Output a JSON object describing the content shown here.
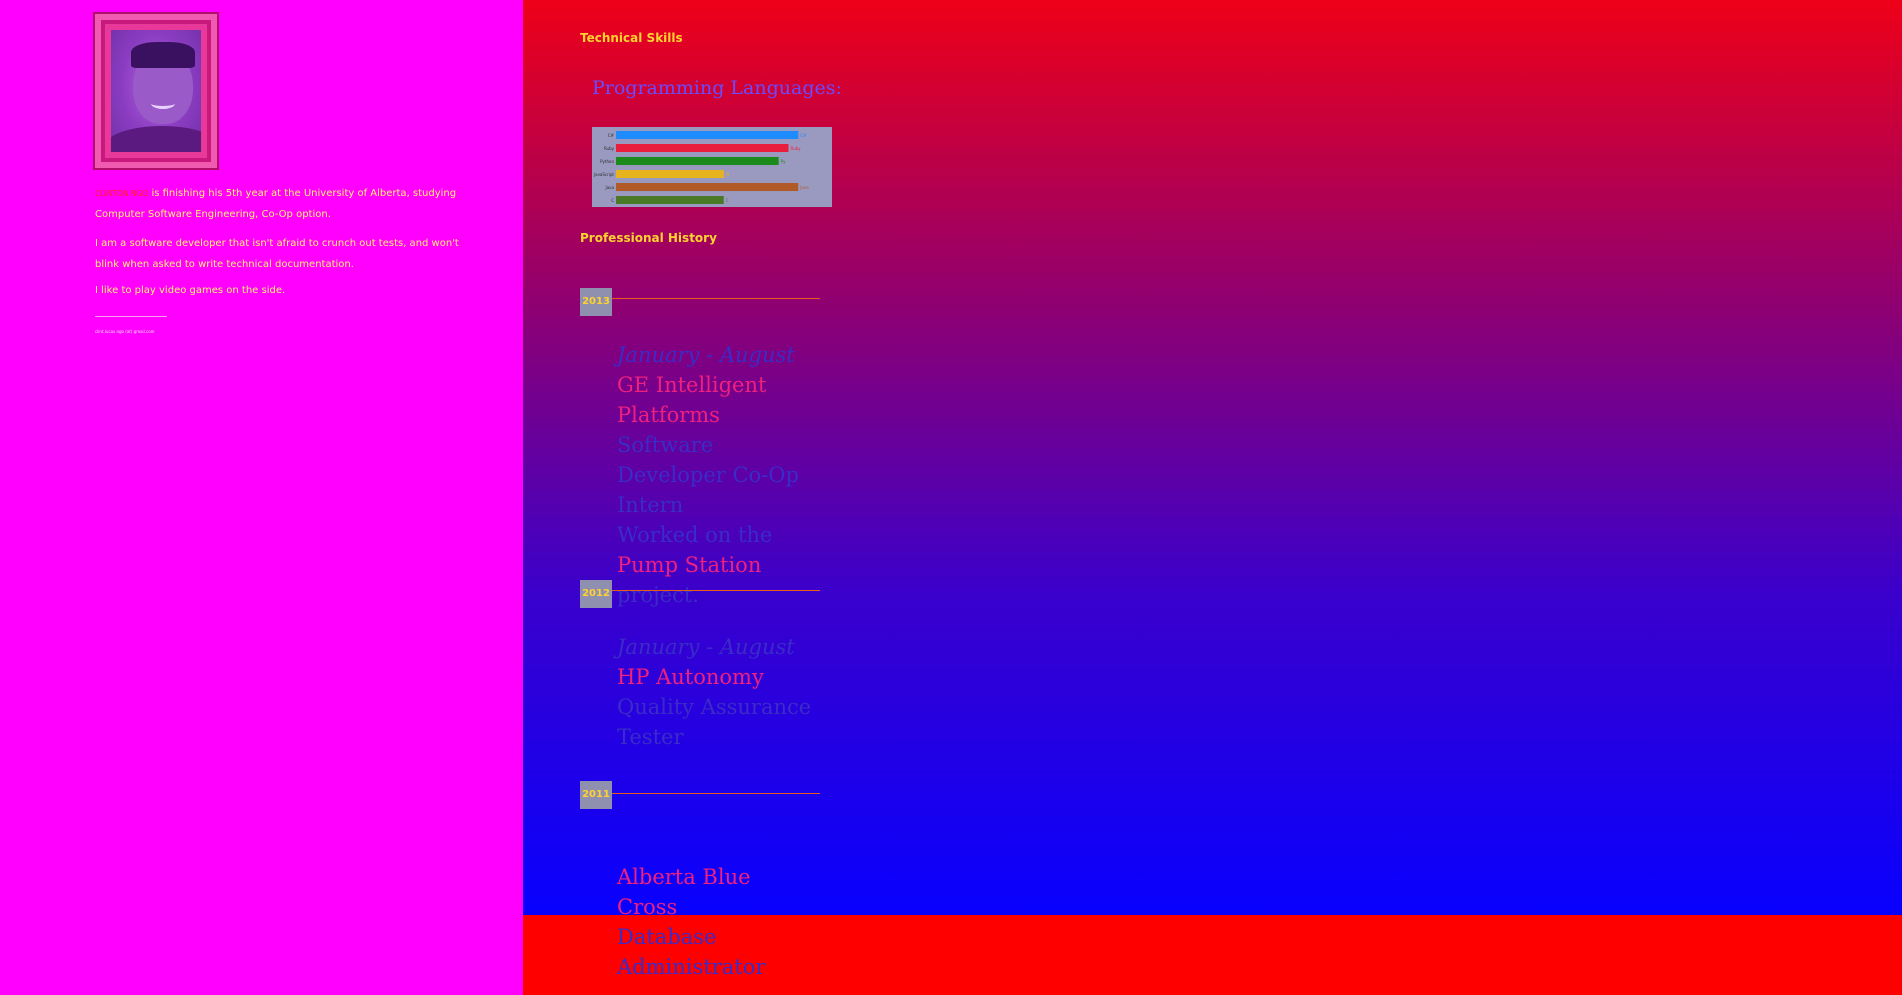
{
  "sidebar": {
    "name": "CLINTON NGO",
    "bio1": " is finishing his 5th year at the University of Alberta, studying Computer Software Engineering, Co-Op option.",
    "bio2": "I am a software developer that isn't afraid to crunch out tests, and won't blink when asked to write technical documentation.",
    "bio3": "I like to play video games on the side.",
    "email": "clint.lucas.ngo (at) gmail.com"
  },
  "skills": {
    "title": "Technical Skills",
    "programming_title": "Programming Languages:"
  },
  "history": {
    "title": "Professional History",
    "entries": [
      {
        "year": "2013",
        "date": "January - August",
        "company": "GE Intelligent Platforms",
        "role": "Software Developer Co-Op Intern",
        "desc_pre": "Worked on the ",
        "desc_hl": "Pump Station",
        "desc_post": " project."
      },
      {
        "year": "2012",
        "date": "January - August",
        "company": "HP Autonomy",
        "role": "Quality Assurance Tester"
      },
      {
        "year": "2011",
        "date": "",
        "company": "Alberta Blue Cross",
        "role": "Database Administrator"
      }
    ]
  },
  "chart_data": {
    "type": "bar",
    "orientation": "horizontal",
    "categories": [
      "C#",
      "Ruby",
      "Python",
      "JavaScript",
      "Java",
      "C"
    ],
    "values": [
      93,
      88,
      83,
      55,
      93,
      55
    ],
    "value_labels": [
      "C#",
      "Ruby",
      "Py",
      "JS",
      "Java",
      "C"
    ],
    "colors": [
      "#1e8cff",
      "#e81e3c",
      "#1a8a1a",
      "#e8b41e",
      "#b05a28",
      "#4a7a28"
    ],
    "xlim": [
      0,
      100
    ]
  }
}
